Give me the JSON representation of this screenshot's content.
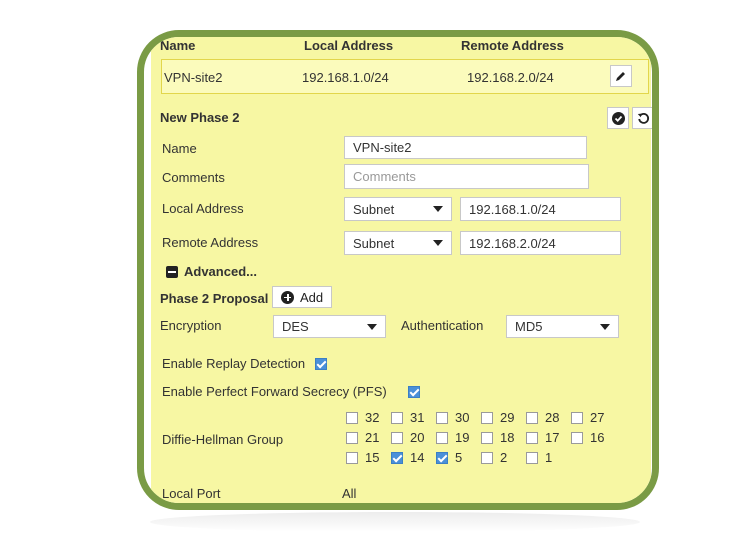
{
  "table": {
    "headers": [
      "Name",
      "Local Address",
      "Remote Address"
    ],
    "row": {
      "name": "VPN-site2",
      "local": "192.168.1.0/24",
      "remote": "192.168.2.0/24"
    }
  },
  "phase2": {
    "title": "New Phase 2",
    "name_label": "Name",
    "name_value": "VPN-site2",
    "comments_label": "Comments",
    "comments_placeholder": "Comments",
    "local_label": "Local Address",
    "local_type": "Subnet",
    "local_value": "192.168.1.0/24",
    "remote_label": "Remote Address",
    "remote_type": "Subnet",
    "remote_value": "192.168.2.0/24",
    "advanced_label": "Advanced...",
    "proposal_label": "Phase 2 Proposal",
    "add_label": "Add",
    "encryption_label": "Encryption",
    "encryption_value": "DES",
    "auth_label": "Authentication",
    "auth_value": "MD5",
    "replay_label": "Enable Replay Detection",
    "replay_checked": true,
    "pfs_label": "Enable Perfect Forward Secrecy (PFS)",
    "pfs_checked": true,
    "dh_label": "Diffie-Hellman Group",
    "dh_groups": [
      {
        "value": "32",
        "checked": false
      },
      {
        "value": "31",
        "checked": false
      },
      {
        "value": "30",
        "checked": false
      },
      {
        "value": "29",
        "checked": false
      },
      {
        "value": "28",
        "checked": false
      },
      {
        "value": "27",
        "checked": false
      },
      {
        "value": "21",
        "checked": false
      },
      {
        "value": "20",
        "checked": false
      },
      {
        "value": "19",
        "checked": false
      },
      {
        "value": "18",
        "checked": false
      },
      {
        "value": "17",
        "checked": false
      },
      {
        "value": "16",
        "checked": false
      },
      {
        "value": "15",
        "checked": false
      },
      {
        "value": "14",
        "checked": true
      },
      {
        "value": "5",
        "checked": true
      },
      {
        "value": "2",
        "checked": false
      },
      {
        "value": "1",
        "checked": false
      }
    ],
    "local_port_label": "Local Port",
    "local_port_value": "All",
    "local_port_checked": true
  },
  "colors": {
    "panel": "#f7f7a3",
    "frame": "#7a9b45",
    "checkbox": "#4a90d9"
  }
}
